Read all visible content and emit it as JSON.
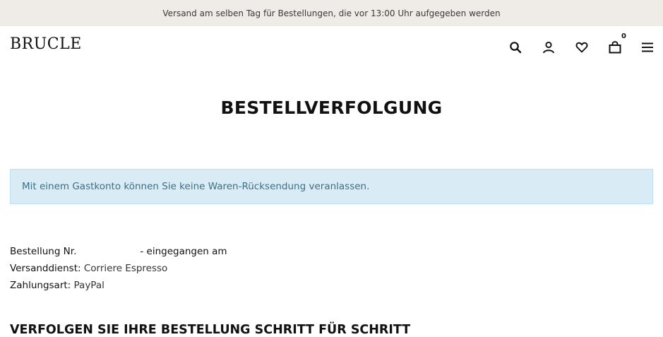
{
  "announcement": {
    "text": "Versand am selben Tag für Bestellungen, die vor 13:00 Uhr aufgegeben werden"
  },
  "header": {
    "logo": "BRUCLE",
    "cart_count": "0",
    "icons": [
      "search-icon",
      "user-icon",
      "heart-icon",
      "bag-icon",
      "menu-icon"
    ]
  },
  "main": {
    "title": "BESTELLVERFOLGUNG",
    "notice": "Mit einem Gastkonto können Sie keine Waren-Rücksendung veranlassen.",
    "order": {
      "number_label": "Bestellung Nr.",
      "received_label": "- eingegangen am",
      "carrier_label": "Versanddienst:",
      "carrier_value": "Corriere Espresso",
      "payment_label": "Zahlungsart:",
      "payment_value": "PayPal"
    },
    "section_title": "VERFOLGEN SIE IHRE BESTELLUNG SCHRITT FÜR SCHRITT"
  }
}
